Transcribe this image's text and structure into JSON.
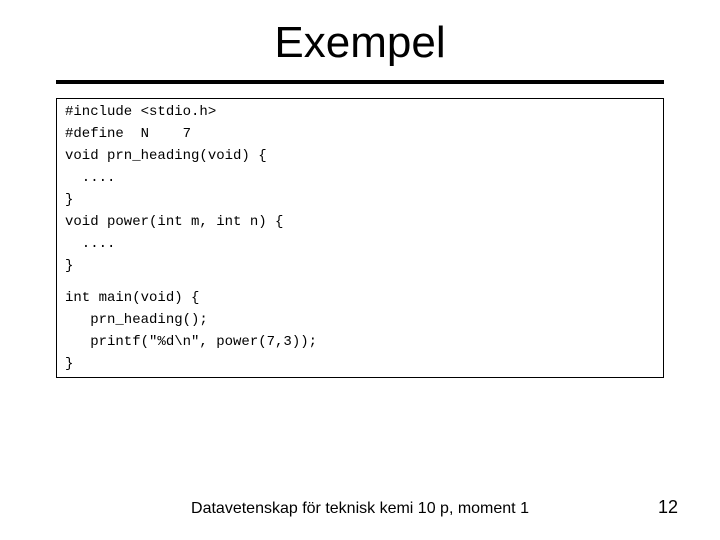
{
  "title": "Exempel",
  "code": {
    "lines": [
      "#include <stdio.h>",
      "#define  N    7",
      "void prn_heading(void) {",
      "  ....",
      "}",
      "void power(int m, int n) {",
      "  ....",
      "}",
      "",
      "int main(void) {",
      "   prn_heading();",
      "   printf(\"%d\\n\", power(7,3));",
      "}"
    ]
  },
  "footer": "Datavetenskap för teknisk kemi 10 p, moment 1",
  "page_number": "12"
}
